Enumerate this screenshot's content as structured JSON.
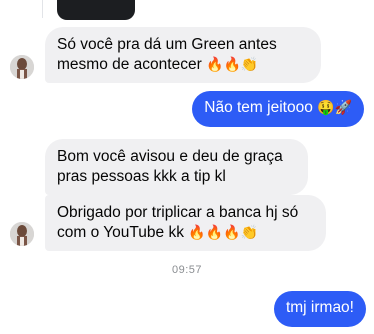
{
  "messages": [
    {
      "id": "m1",
      "direction": "incoming",
      "text": "Só você pra dá um Green antes mesmo de acontecer",
      "emojis": "🔥🔥👏"
    },
    {
      "id": "m2",
      "direction": "outgoing",
      "text": "Não tem jeitooo",
      "emojis": "🤑🚀"
    },
    {
      "id": "m3",
      "direction": "incoming",
      "text": "Bom você avisou e deu de graça pras pessoas kkk a tip kl"
    },
    {
      "id": "m4",
      "direction": "incoming",
      "text": "Obrigado por triplicar a banca hj só com o YouTube kk",
      "emojis": "🔥🔥🔥👏"
    },
    {
      "id": "m5",
      "direction": "outgoing",
      "text": "tmj irmao!"
    }
  ],
  "timestamp": "09:57",
  "colors": {
    "incoming_bubble": "#f0f0f2",
    "outgoing_bubble": "#2d5cf6"
  }
}
